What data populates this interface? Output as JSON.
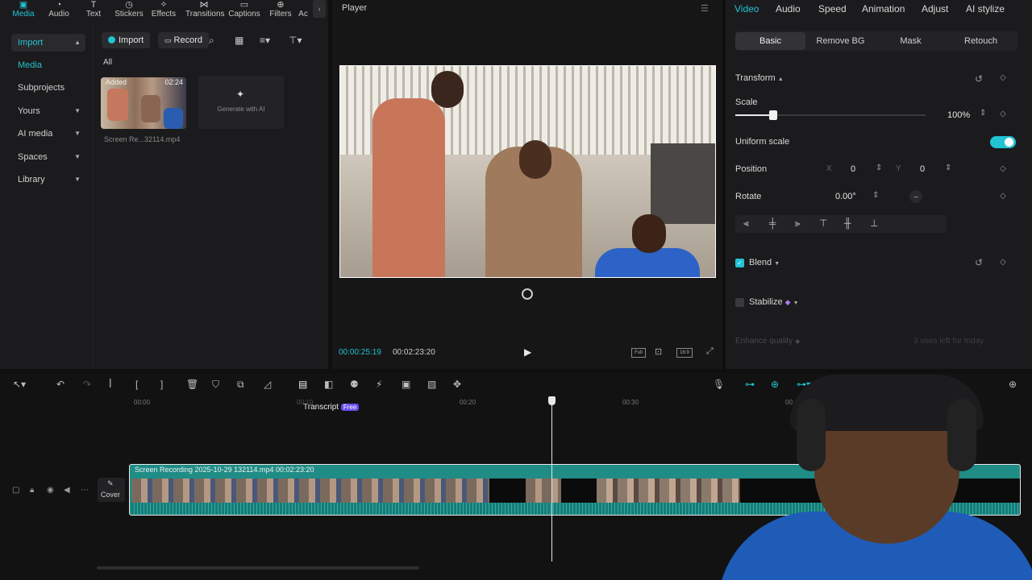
{
  "top_tabs": [
    {
      "label": "Media",
      "icon": "media-icon"
    },
    {
      "label": "Audio",
      "icon": "audio-icon"
    },
    {
      "label": "Text",
      "icon": "text-icon"
    },
    {
      "label": "Stickers",
      "icon": "stickers-icon"
    },
    {
      "label": "Effects",
      "icon": "effects-icon"
    },
    {
      "label": "Transitions",
      "icon": "transitions-icon"
    },
    {
      "label": "Captions",
      "icon": "captions-icon"
    },
    {
      "label": "Filters",
      "icon": "filters-icon"
    },
    {
      "label": "Ac",
      "icon": "adjust-icon"
    }
  ],
  "sidebar": {
    "items": [
      {
        "label": "Import"
      },
      {
        "label": "Media"
      },
      {
        "label": "Subprojects"
      },
      {
        "label": "Yours"
      },
      {
        "label": "AI media"
      },
      {
        "label": "Spaces"
      },
      {
        "label": "Library"
      }
    ]
  },
  "media_toolbar": {
    "import_label": "Import",
    "record_label": "Record",
    "filter_all": "All"
  },
  "media_items": [
    {
      "badge": "Added",
      "duration": "02:24",
      "name": "Screen Re...32114.mp4"
    }
  ],
  "generate_ai": "Generate with AI",
  "player": {
    "title": "Player",
    "current_time": "00:00:25:19",
    "total_time": "00:02:23:20",
    "full_label": "Full",
    "ratio_label": "16:9"
  },
  "props": {
    "tabs": [
      "Video",
      "Audio",
      "Speed",
      "Animation",
      "Adjust",
      "AI stylize"
    ],
    "subtabs": [
      "Basic",
      "Remove BG",
      "Mask",
      "Retouch"
    ],
    "transform_label": "Transform",
    "scale_label": "Scale",
    "scale_value": "100%",
    "scale_level": 0.1,
    "uniform_scale_label": "Uniform scale",
    "position_label": "Position",
    "x_label": "X",
    "x_value": "0",
    "y_label": "Y",
    "y_value": "0",
    "rotate_label": "Rotate",
    "rotate_value": "0.00°",
    "blend_label": "Blend",
    "stabilize_label": "Stabilize",
    "enhance_label": "Enhance quality",
    "uses_left": "3 uses left for today"
  },
  "timeline": {
    "ruler": [
      "00:00",
      "00:10",
      "00:20",
      "00:30",
      "00:40"
    ],
    "tooltip": "Transcript",
    "tooltip_badge": "Free",
    "cover_label": "Cover",
    "clip_label": "Screen Recording 2025-10-29 132114.mp4   00:02:23:20"
  },
  "colors": {
    "accent": "#22c3d3",
    "clip": "#1f8c86"
  }
}
